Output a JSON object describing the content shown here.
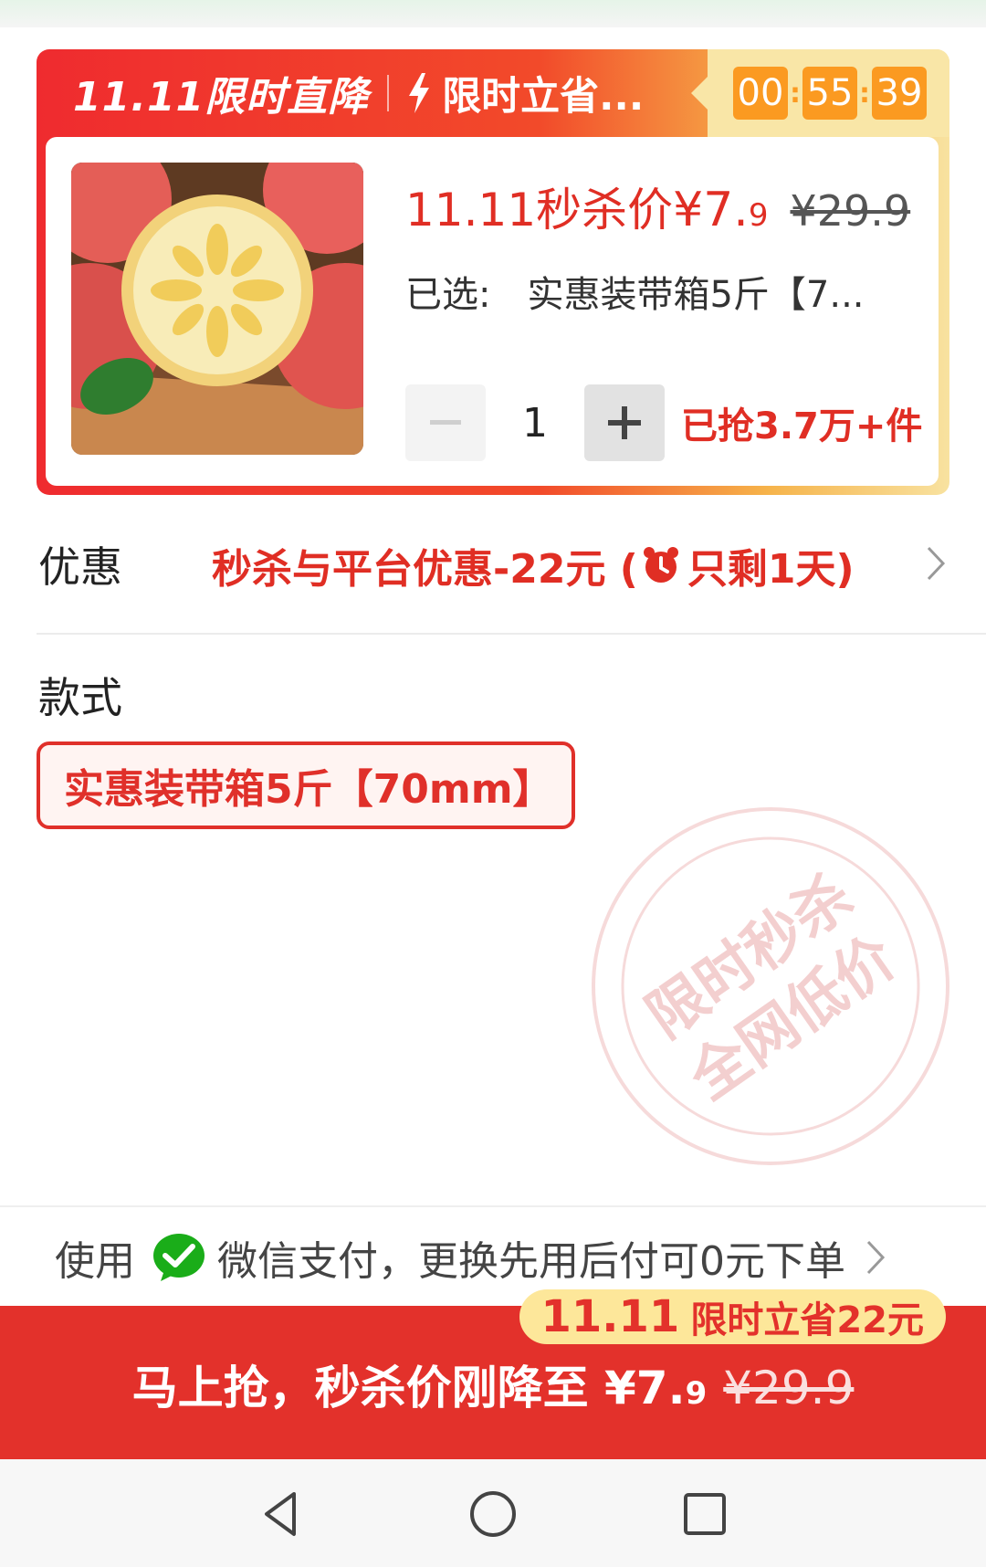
{
  "header": {
    "brand": "11.11限时直降",
    "slogan": "限时立省...",
    "countdown": {
      "hours": "00",
      "minutes": "55",
      "seconds": "39"
    }
  },
  "product": {
    "price_label": "11.11秒杀价",
    "price_main": "¥7.",
    "price_decimal": "9",
    "price_original": "¥29.9",
    "selected_label": "已选:",
    "selected_value": "实惠装带箱5斤【7...",
    "quantity": "1",
    "sold": "已抢3.7万+件"
  },
  "promo": {
    "label": "优惠",
    "text_prefix": "秒杀与平台优惠-22元 (",
    "text_suffix": "只剩1天)"
  },
  "style": {
    "label": "款式",
    "options": [
      "实惠装带箱5斤【70mm】"
    ]
  },
  "stamp": {
    "line1": "限时秒杀",
    "line2": "全网低价"
  },
  "payment": {
    "use": "使用",
    "text": "微信支付，更换先用后付可0元下单"
  },
  "cta": {
    "badge_big": "11.11",
    "badge_text": "限时立省22元",
    "text": "马上抢，秒杀价刚降至 ¥7.",
    "decimal": "9",
    "original": "¥29.9"
  },
  "colors": {
    "accent": "#e3312b",
    "timer": "#fb9a21",
    "badge": "#fde79a"
  }
}
